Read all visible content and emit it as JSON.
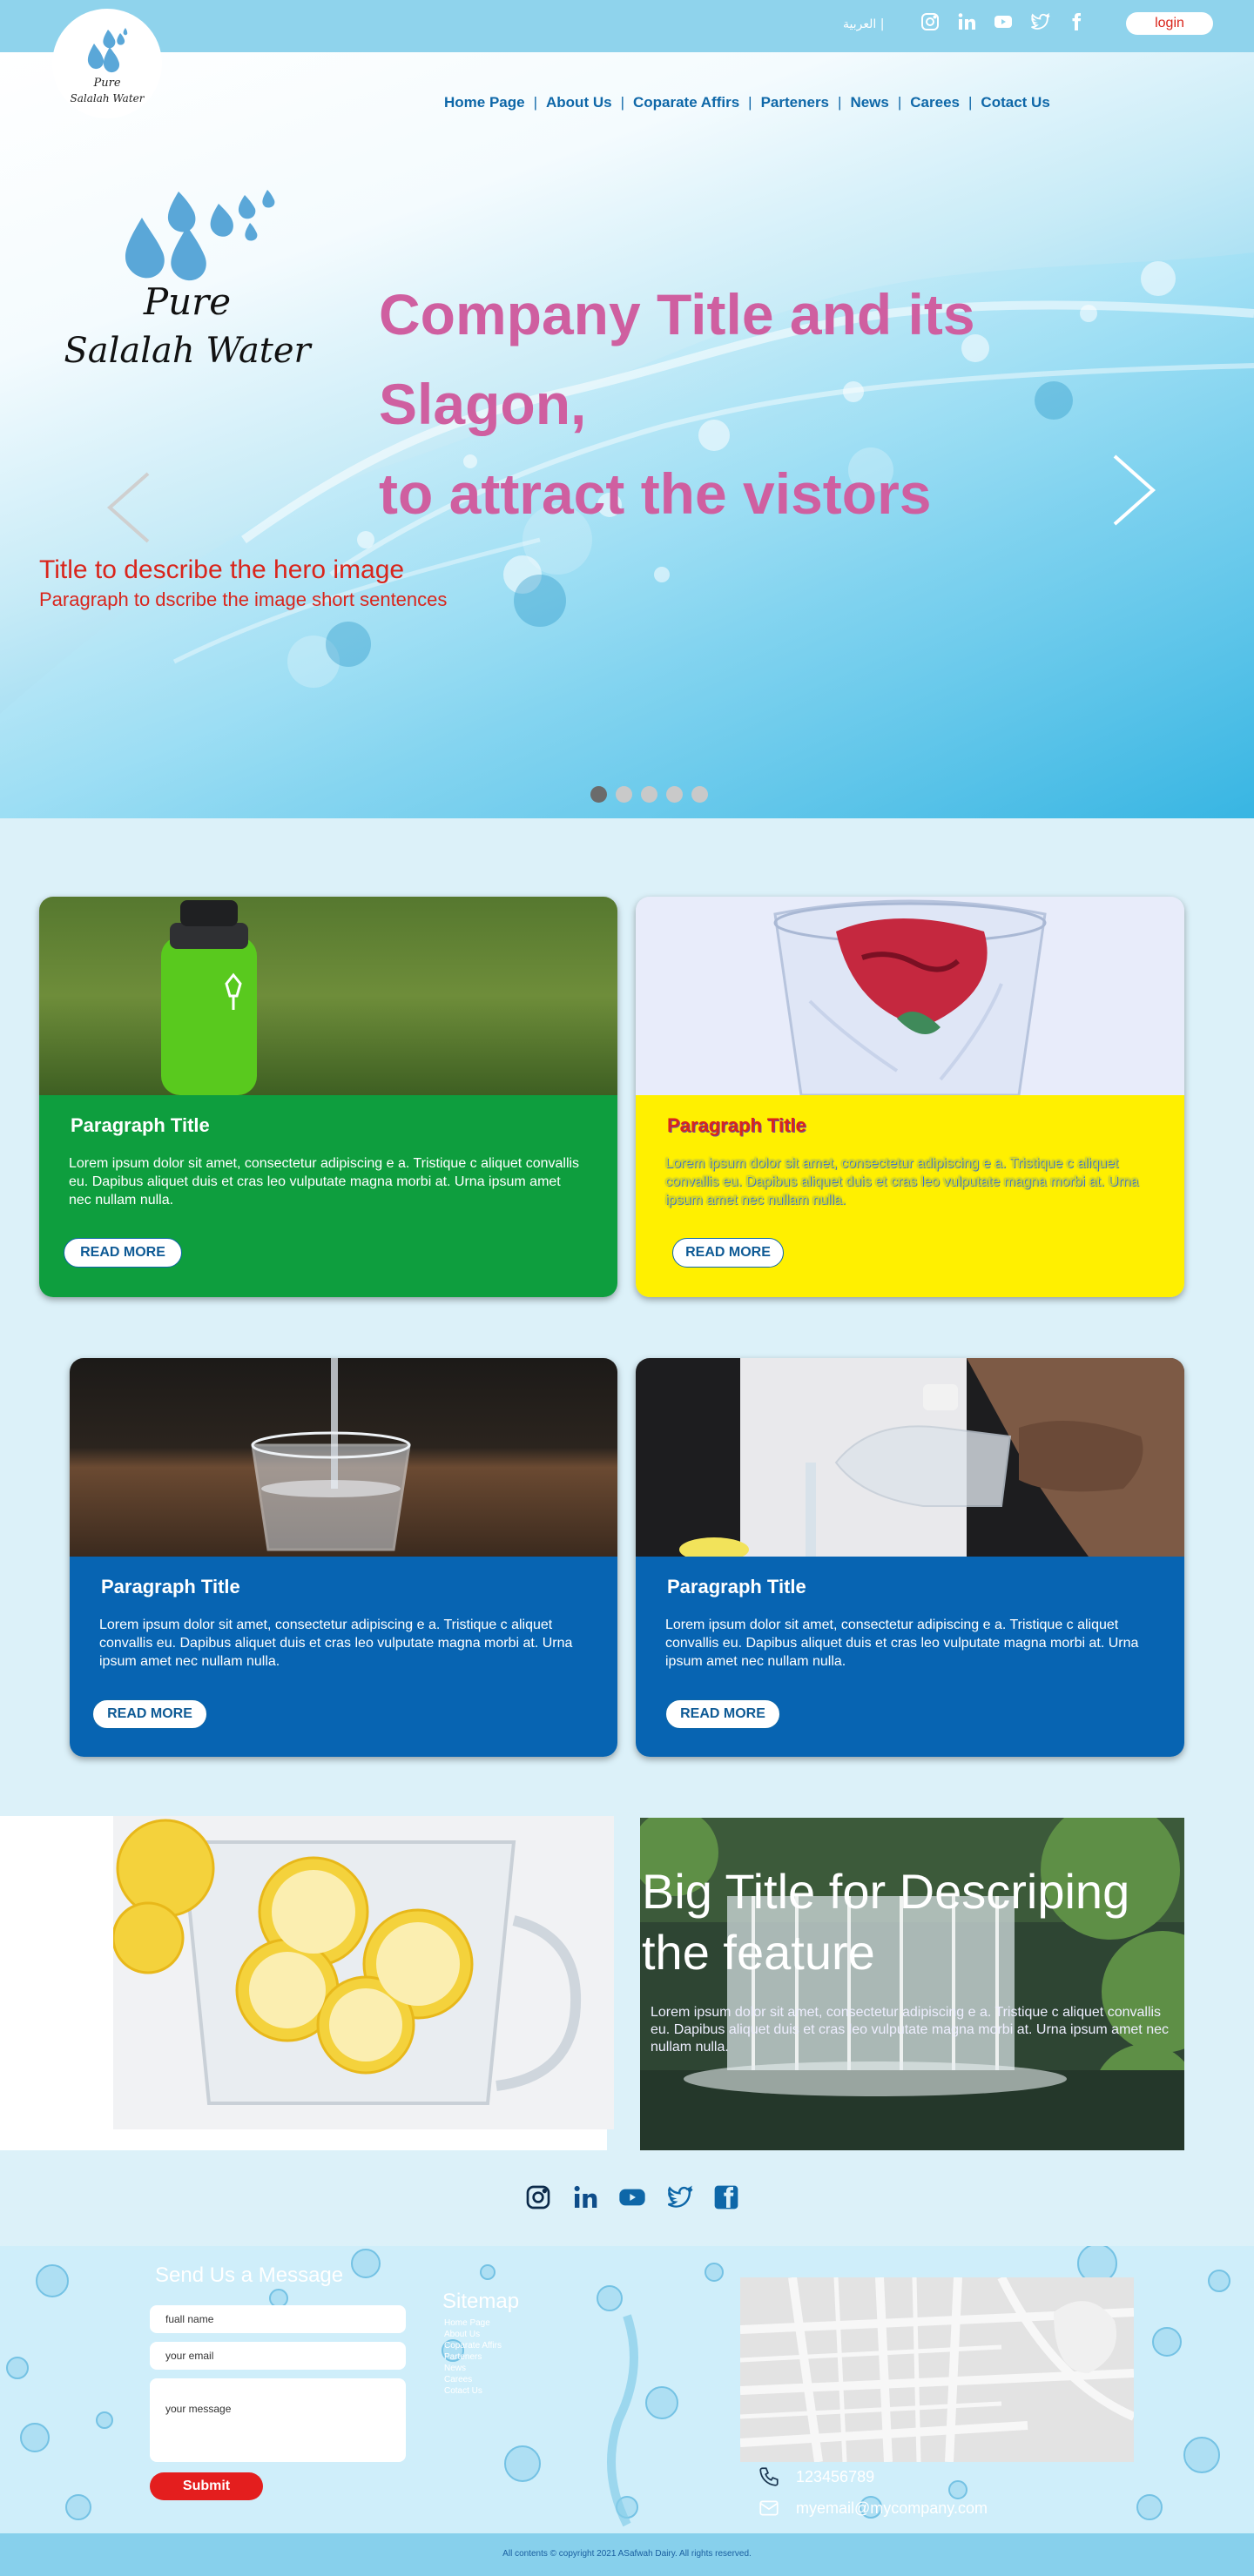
{
  "topbar": {
    "language": "العربية |",
    "login_label": "login"
  },
  "logo": {
    "line1": "Pure",
    "line2": "Salalah Water"
  },
  "nav": {
    "items": [
      "Home Page",
      "About Us",
      "Coparate Affirs",
      "Parteners",
      "News",
      "Carees",
      "Cotact Us"
    ]
  },
  "hero": {
    "logo_line1": "Pure",
    "logo_line2": "Salalah Water",
    "title_line1": "Company Title and its Slagon,",
    "title_line2": "to attract the vistors",
    "image_title": "Title to describe the hero image",
    "image_paragraph": "Paragraph to dscribe the image  short sentences",
    "slide_count": 5,
    "active_slide": 1
  },
  "cards": [
    {
      "title": "Paragraph Title",
      "text": "Lorem ipsum dolor sit amet, consectetur adipiscing e a. Tristique c aliquet convallis eu. Dapibus aliquet duis et cras leo vulputate magna morbi at. Urna ipsum amet nec nullam nulla.",
      "button": "READ MORE",
      "color": "#0e9e3e"
    },
    {
      "title": "Paragraph Title",
      "text": "Lorem ipsum dolor sit amet, consectetur adipiscing e a. Tristique c aliquet convallis eu. Dapibus aliquet duis et cras leo vulputate magna morbi at. Urna ipsum amet nec nullam nulla.",
      "button": "READ MORE",
      "color": "#fff000"
    },
    {
      "title": "Paragraph Title",
      "text": "Lorem ipsum dolor sit amet, consectetur adipiscing e a. Tristique c aliquet convallis eu. Dapibus aliquet duis et cras leo vulputate magna morbi at. Urna ipsum amet nec nullam nulla.",
      "button": "READ MORE",
      "color": "#0764b2"
    },
    {
      "title": "Paragraph Title",
      "text": "Lorem ipsum dolor sit amet, consectetur adipiscing e a. Tristique c aliquet convallis eu. Dapibus aliquet duis et cras leo vulputate magna morbi at. Urna ipsum amet nec nullam nulla.",
      "button": "READ MORE",
      "color": "#0764b2"
    }
  ],
  "feature": {
    "title": "Big Title for Descriping the feature",
    "text": "Lorem ipsum dolor sit amet, consectetur adipiscing e a. Tristique c aliquet convallis eu. Dapibus aliquet duis et cras leo vulputate magna morbi at. Urna ipsum amet nec nullam nulla."
  },
  "social": [
    "instagram-icon",
    "linkedin-icon",
    "youtube-icon",
    "twitter-icon",
    "facebook-icon"
  ],
  "footer": {
    "form_title": "Send Us a Message",
    "name_placeholder": "fuall name",
    "email_placeholder": "your email",
    "message_placeholder": "your message",
    "submit_label": "Submit",
    "sitemap_title": "Sitemap",
    "sitemap_items": [
      "Home Page",
      "About Us",
      "Coparate Affirs",
      "Parteners",
      "News",
      "Carees",
      "Cotact Us"
    ],
    "phone": "123456789",
    "email": "myemail@mycompany.com",
    "copyright": "All contents © copyright 2021 ASafwah Dairy. All rights reserved."
  },
  "colors": {
    "nav_blue": "#0e67a8",
    "hero_title_pink": "#cf5fa0",
    "hero_sub_red": "#d9251c",
    "submit_red": "#e41e1e"
  }
}
